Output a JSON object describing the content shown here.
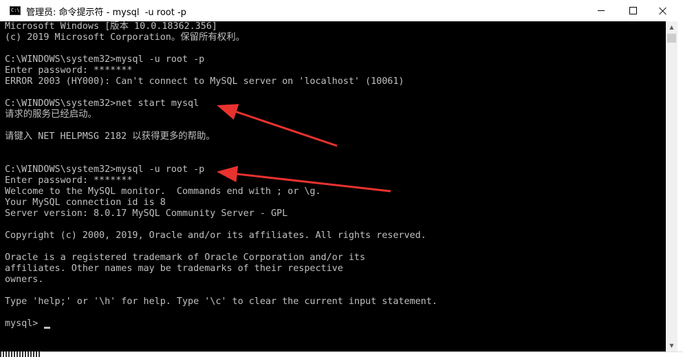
{
  "window": {
    "title": "管理员: 命令提示符 - mysql  -u root -p",
    "icon": "cmd-icon",
    "icon_text": "C:\\",
    "controls": {
      "minimize_icon": "minimize-icon",
      "maximize_icon": "maximize-icon",
      "close_icon": "close-icon"
    }
  },
  "console": {
    "background": "#000000",
    "text_color": "#c0c0c0",
    "lines": [
      "Microsoft Windows [版本 10.0.18362.356]",
      "(c) 2019 Microsoft Corporation。保留所有权利。",
      "",
      "C:\\WINDOWS\\system32>mysql -u root -p",
      "Enter password: *******",
      "ERROR 2003 (HY000): Can't connect to MySQL server on 'localhost' (10061)",
      "",
      "C:\\WINDOWS\\system32>net start mysql",
      "请求的服务已经启动。",
      "",
      "请键入 NET HELPMSG 2182 以获得更多的帮助。",
      "",
      "",
      "C:\\WINDOWS\\system32>mysql -u root -p",
      "Enter password: *******",
      "Welcome to the MySQL monitor.  Commands end with ; or \\g.",
      "Your MySQL connection id is 8",
      "Server version: 8.0.17 MySQL Community Server - GPL",
      "",
      "Copyright (c) 2000, 2019, Oracle and/or its affiliates. All rights reserved.",
      "",
      "Oracle is a registered trademark of Oracle Corporation and/or its",
      "affiliates. Other names may be trademarks of their respective",
      "owners.",
      "",
      "Type 'help;' or '\\h' for help. Type '\\c' to clear the current input statement.",
      "",
      "mysql> "
    ]
  },
  "annotations": {
    "arrow_color": "#e8322f"
  }
}
